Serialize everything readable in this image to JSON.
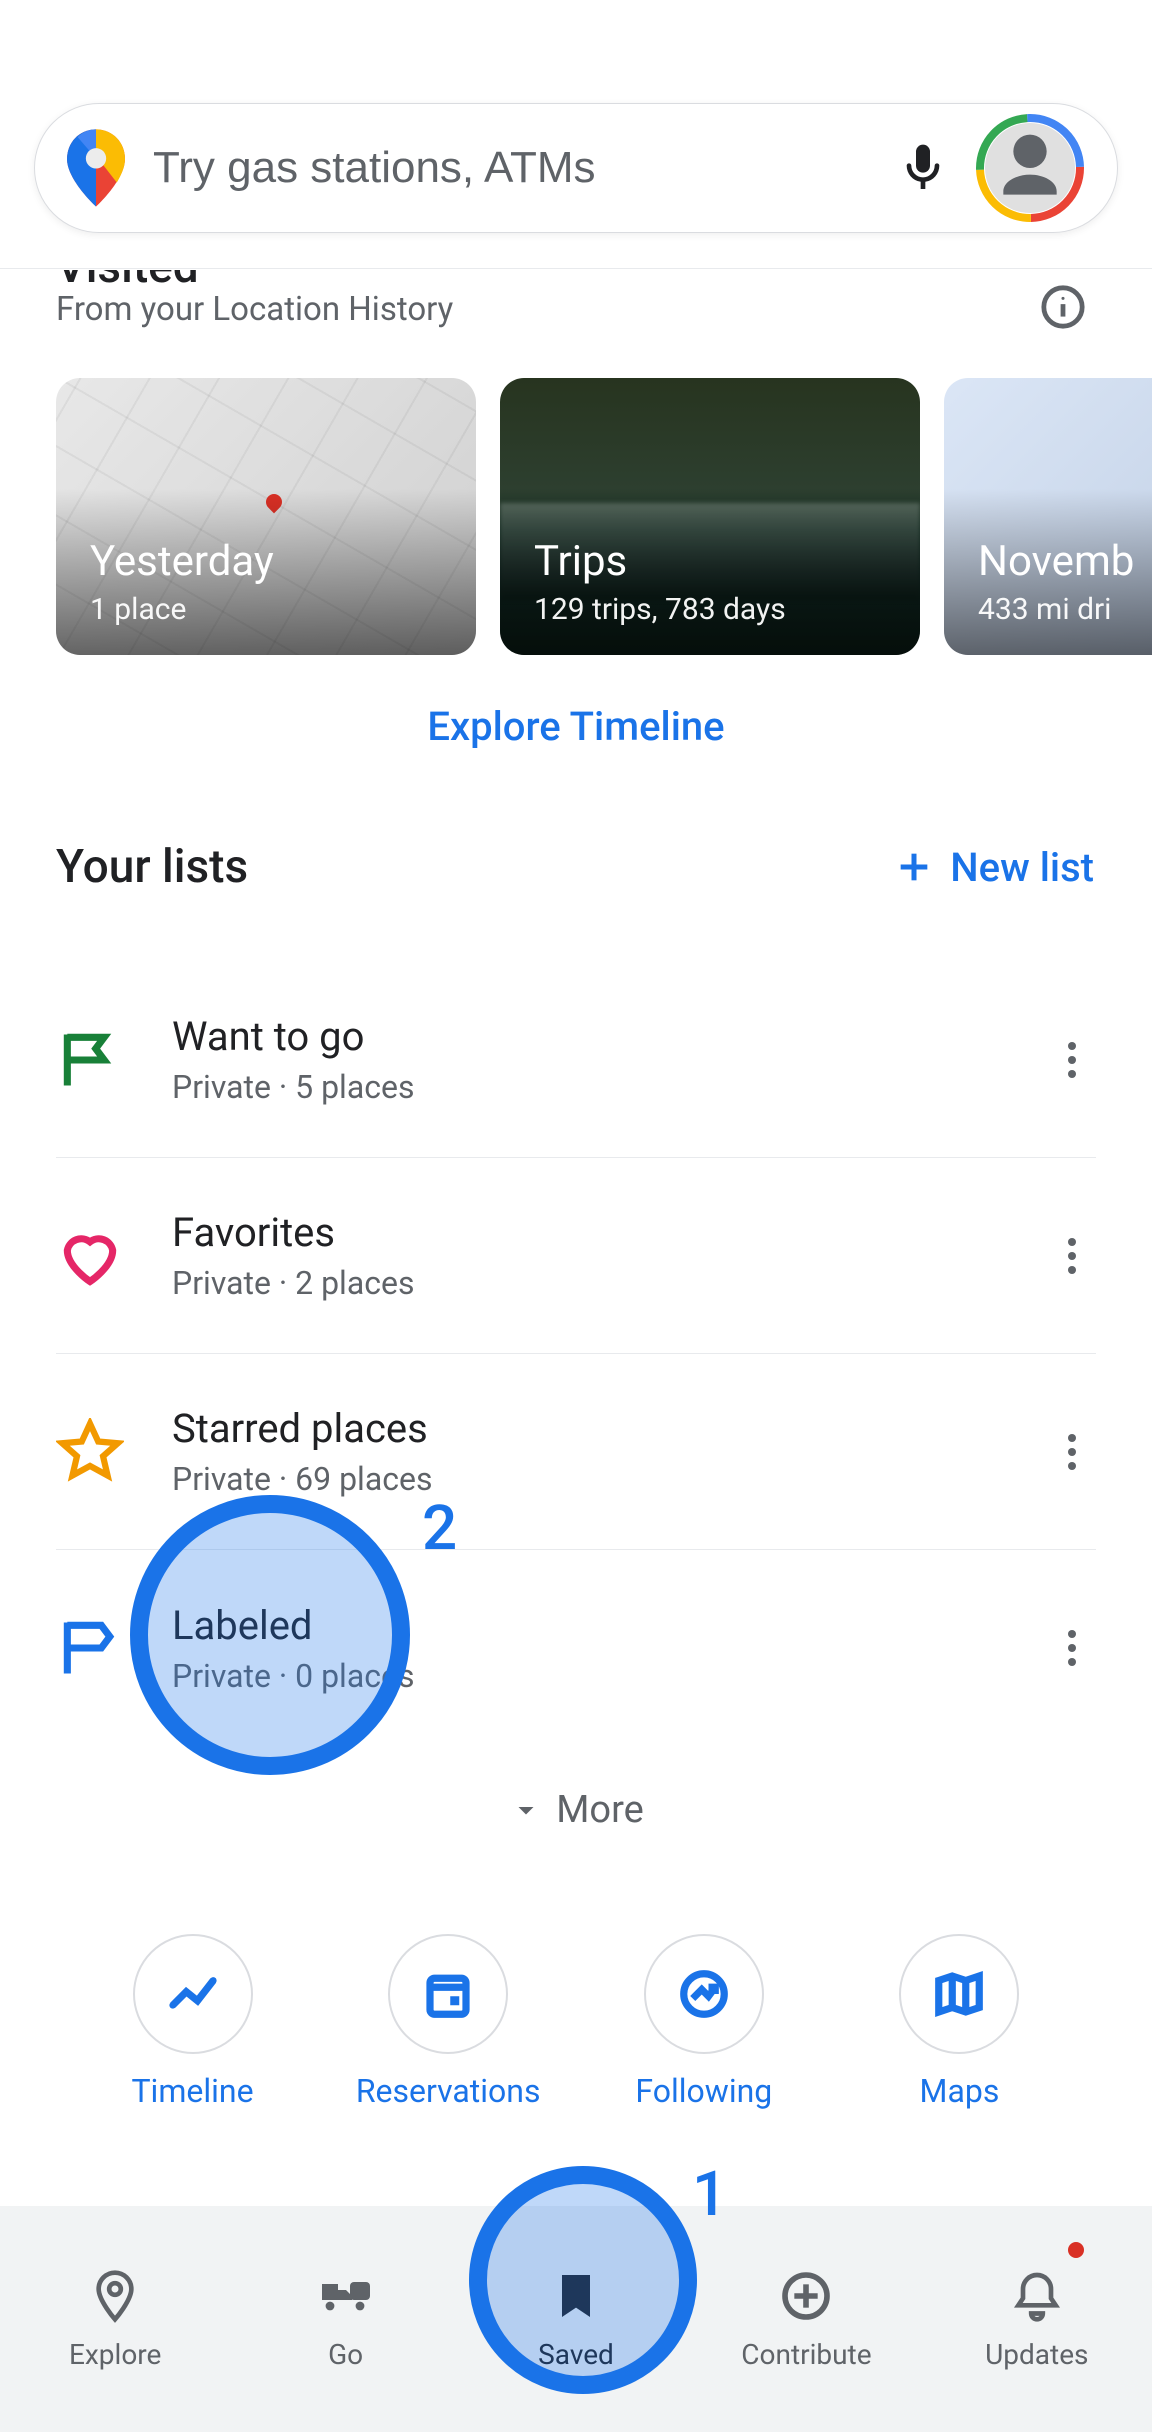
{
  "search": {
    "placeholder": "Try gas stations, ATMs"
  },
  "visited": {
    "partial_title": "Visited",
    "subtitle": "From your Location History"
  },
  "timeline_cards": [
    {
      "title": "Yesterday",
      "subtitle": "1 place"
    },
    {
      "title": "Trips",
      "subtitle": "129 trips,  783 days"
    },
    {
      "title": "Novemb",
      "subtitle": "433 mi dri"
    }
  ],
  "explore_timeline_label": "Explore Timeline",
  "lists_header": {
    "title": "Your lists",
    "new_list_label": "New list"
  },
  "lists": [
    {
      "icon": "flag-green",
      "name": "Want to go",
      "meta": "Private · 5 places"
    },
    {
      "icon": "heart-pink",
      "name": "Favorites",
      "meta": "Private · 2 places"
    },
    {
      "icon": "star-orange",
      "name": "Starred places",
      "meta": "Private · 69 places"
    },
    {
      "icon": "flag-blue",
      "name": "Labeled",
      "meta": "Private · 0 places"
    }
  ],
  "more_label": "More",
  "quick_links": [
    {
      "icon": "timeline",
      "label": "Timeline"
    },
    {
      "icon": "reservations",
      "label": "Reservations"
    },
    {
      "icon": "following",
      "label": "Following"
    },
    {
      "icon": "maps",
      "label": "Maps"
    }
  ],
  "bottom_nav": [
    {
      "icon": "explore",
      "label": "Explore",
      "active": false,
      "badge": false
    },
    {
      "icon": "go",
      "label": "Go",
      "active": false,
      "badge": false
    },
    {
      "icon": "saved",
      "label": "Saved",
      "active": true,
      "badge": false
    },
    {
      "icon": "contribute",
      "label": "Contribute",
      "active": false,
      "badge": false
    },
    {
      "icon": "updates",
      "label": "Updates",
      "active": false,
      "badge": true
    }
  ],
  "tutorial_highlights": {
    "step1_label": "1",
    "step2_label": "2"
  }
}
